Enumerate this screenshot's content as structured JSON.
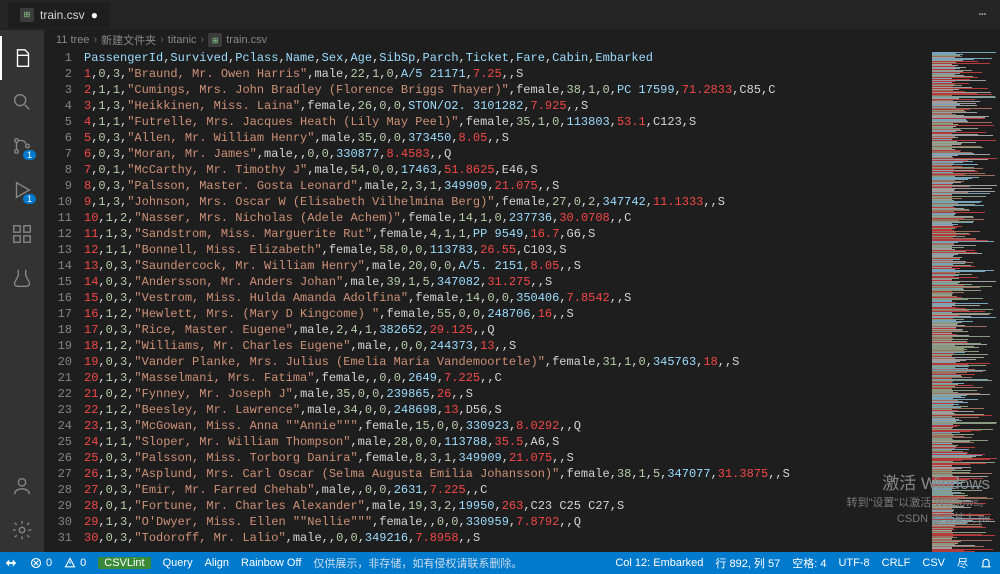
{
  "title_tab": "train.csv",
  "tab_dirty": "●",
  "breadcrumbs": {
    "seg1": "11 tree",
    "seg2": "新建文件夹",
    "seg3": "titanic",
    "seg4": "train.csv"
  },
  "activity_badges": {
    "scm": "1",
    "debug": "1"
  },
  "watermark": {
    "line1": "激活 Windows",
    "line2": "转到\"设置\"以激活 Windows。",
    "line3": "CSDN @书某人.px"
  },
  "statusbar": {
    "errors": "0",
    "warnings": "0",
    "csvlint": "CSVLint",
    "query": "Query",
    "align": "Align",
    "rainbow": "Rainbow Off",
    "mid_text": "仅供展示，非存储，如有侵权请联系删除。",
    "col_label": "Col 12: Embarked",
    "pos": "行 892, 列 57",
    "spaces": "空格: 4",
    "encoding": "UTF-8",
    "eol": "CRLF",
    "lang": "CSV",
    "feedback": "尽"
  },
  "header_cols": [
    "PassengerId",
    "Survived",
    "Pclass",
    "Name",
    "Sex",
    "Age",
    "SibSp",
    "Parch",
    "Ticket",
    "Fare",
    "Cabin",
    "Embarked"
  ],
  "rows": [
    {
      "id": "1",
      "sv": "0",
      "pc": "3",
      "nm": "Braund, Mr. Owen Harris",
      "sx": "male",
      "ag": "22",
      "sp": "1",
      "pa": "0",
      "tk": "A/5 21171",
      "fr": "7.25",
      "cb": "",
      "em": "S"
    },
    {
      "id": "2",
      "sv": "1",
      "pc": "1",
      "nm": "Cumings, Mrs. John Bradley (Florence Briggs Thayer)",
      "sx": "female",
      "ag": "38",
      "sp": "1",
      "pa": "0",
      "tk": "PC 17599",
      "fr": "71.2833",
      "cb": "C85",
      "em": "C"
    },
    {
      "id": "3",
      "sv": "1",
      "pc": "3",
      "nm": "Heikkinen, Miss. Laina",
      "sx": "female",
      "ag": "26",
      "sp": "0",
      "pa": "0",
      "tk": "STON/O2. 3101282",
      "fr": "7.925",
      "cb": "",
      "em": "S"
    },
    {
      "id": "4",
      "sv": "1",
      "pc": "1",
      "nm": "Futrelle, Mrs. Jacques Heath (Lily May Peel)",
      "sx": "female",
      "ag": "35",
      "sp": "1",
      "pa": "0",
      "tk": "113803",
      "fr": "53.1",
      "cb": "C123",
      "em": "S"
    },
    {
      "id": "5",
      "sv": "0",
      "pc": "3",
      "nm": "Allen, Mr. William Henry",
      "sx": "male",
      "ag": "35",
      "sp": "0",
      "pa": "0",
      "tk": "373450",
      "fr": "8.05",
      "cb": "",
      "em": "S"
    },
    {
      "id": "6",
      "sv": "0",
      "pc": "3",
      "nm": "Moran, Mr. James",
      "sx": "male",
      "ag": "",
      "sp": "0",
      "pa": "0",
      "tk": "330877",
      "fr": "8.4583",
      "cb": "",
      "em": "Q"
    },
    {
      "id": "7",
      "sv": "0",
      "pc": "1",
      "nm": "McCarthy, Mr. Timothy J",
      "sx": "male",
      "ag": "54",
      "sp": "0",
      "pa": "0",
      "tk": "17463",
      "fr": "51.8625",
      "cb": "E46",
      "em": "S"
    },
    {
      "id": "8",
      "sv": "0",
      "pc": "3",
      "nm": "Palsson, Master. Gosta Leonard",
      "sx": "male",
      "ag": "2",
      "sp": "3",
      "pa": "1",
      "tk": "349909",
      "fr": "21.075",
      "cb": "",
      "em": "S"
    },
    {
      "id": "9",
      "sv": "1",
      "pc": "3",
      "nm": "Johnson, Mrs. Oscar W (Elisabeth Vilhelmina Berg)",
      "sx": "female",
      "ag": "27",
      "sp": "0",
      "pa": "2",
      "tk": "347742",
      "fr": "11.1333",
      "cb": "",
      "em": "S"
    },
    {
      "id": "10",
      "sv": "1",
      "pc": "2",
      "nm": "Nasser, Mrs. Nicholas (Adele Achem)",
      "sx": "female",
      "ag": "14",
      "sp": "1",
      "pa": "0",
      "tk": "237736",
      "fr": "30.0708",
      "cb": "",
      "em": "C"
    },
    {
      "id": "11",
      "sv": "1",
      "pc": "3",
      "nm": "Sandstrom, Miss. Marguerite Rut",
      "sx": "female",
      "ag": "4",
      "sp": "1",
      "pa": "1",
      "tk": "PP 9549",
      "fr": "16.7",
      "cb": "G6",
      "em": "S"
    },
    {
      "id": "12",
      "sv": "1",
      "pc": "1",
      "nm": "Bonnell, Miss. Elizabeth",
      "sx": "female",
      "ag": "58",
      "sp": "0",
      "pa": "0",
      "tk": "113783",
      "fr": "26.55",
      "cb": "C103",
      "em": "S"
    },
    {
      "id": "13",
      "sv": "0",
      "pc": "3",
      "nm": "Saundercock, Mr. William Henry",
      "sx": "male",
      "ag": "20",
      "sp": "0",
      "pa": "0",
      "tk": "A/5. 2151",
      "fr": "8.05",
      "cb": "",
      "em": "S"
    },
    {
      "id": "14",
      "sv": "0",
      "pc": "3",
      "nm": "Andersson, Mr. Anders Johan",
      "sx": "male",
      "ag": "39",
      "sp": "1",
      "pa": "5",
      "tk": "347082",
      "fr": "31.275",
      "cb": "",
      "em": "S"
    },
    {
      "id": "15",
      "sv": "0",
      "pc": "3",
      "nm": "Vestrom, Miss. Hulda Amanda Adolfina",
      "sx": "female",
      "ag": "14",
      "sp": "0",
      "pa": "0",
      "tk": "350406",
      "fr": "7.8542",
      "cb": "",
      "em": "S"
    },
    {
      "id": "16",
      "sv": "1",
      "pc": "2",
      "nm": "Hewlett, Mrs. (Mary D Kingcome) ",
      "sx": "female",
      "ag": "55",
      "sp": "0",
      "pa": "0",
      "tk": "248706",
      "fr": "16",
      "cb": "",
      "em": "S"
    },
    {
      "id": "17",
      "sv": "0",
      "pc": "3",
      "nm": "Rice, Master. Eugene",
      "sx": "male",
      "ag": "2",
      "sp": "4",
      "pa": "1",
      "tk": "382652",
      "fr": "29.125",
      "cb": "",
      "em": "Q"
    },
    {
      "id": "18",
      "sv": "1",
      "pc": "2",
      "nm": "Williams, Mr. Charles Eugene",
      "sx": "male",
      "ag": "",
      "sp": "0",
      "pa": "0",
      "tk": "244373",
      "fr": "13",
      "cb": "",
      "em": "S"
    },
    {
      "id": "19",
      "sv": "0",
      "pc": "3",
      "nm": "Vander Planke, Mrs. Julius (Emelia Maria Vandemoortele)",
      "sx": "female",
      "ag": "31",
      "sp": "1",
      "pa": "0",
      "tk": "345763",
      "fr": "18",
      "cb": "",
      "em": "S"
    },
    {
      "id": "20",
      "sv": "1",
      "pc": "3",
      "nm": "Masselmani, Mrs. Fatima",
      "sx": "female",
      "ag": "",
      "sp": "0",
      "pa": "0",
      "tk": "2649",
      "fr": "7.225",
      "cb": "",
      "em": "C"
    },
    {
      "id": "21",
      "sv": "0",
      "pc": "2",
      "nm": "Fynney, Mr. Joseph J",
      "sx": "male",
      "ag": "35",
      "sp": "0",
      "pa": "0",
      "tk": "239865",
      "fr": "26",
      "cb": "",
      "em": "S"
    },
    {
      "id": "22",
      "sv": "1",
      "pc": "2",
      "nm": "Beesley, Mr. Lawrence",
      "sx": "male",
      "ag": "34",
      "sp": "0",
      "pa": "0",
      "tk": "248698",
      "fr": "13",
      "cb": "D56",
      "em": "S"
    },
    {
      "id": "23",
      "sv": "1",
      "pc": "3",
      "nm": "McGowan, Miss. Anna \"\"Annie\"\"",
      "sx": "female",
      "ag": "15",
      "sp": "0",
      "pa": "0",
      "tk": "330923",
      "fr": "8.0292",
      "cb": "",
      "em": "Q"
    },
    {
      "id": "24",
      "sv": "1",
      "pc": "1",
      "nm": "Sloper, Mr. William Thompson",
      "sx": "male",
      "ag": "28",
      "sp": "0",
      "pa": "0",
      "tk": "113788",
      "fr": "35.5",
      "cb": "A6",
      "em": "S"
    },
    {
      "id": "25",
      "sv": "0",
      "pc": "3",
      "nm": "Palsson, Miss. Torborg Danira",
      "sx": "female",
      "ag": "8",
      "sp": "3",
      "pa": "1",
      "tk": "349909",
      "fr": "21.075",
      "cb": "",
      "em": "S"
    },
    {
      "id": "26",
      "sv": "1",
      "pc": "3",
      "nm": "Asplund, Mrs. Carl Oscar (Selma Augusta Emilia Johansson)",
      "sx": "female",
      "ag": "38",
      "sp": "1",
      "pa": "5",
      "tk": "347077",
      "fr": "31.3875",
      "cb": "",
      "em": "S"
    },
    {
      "id": "27",
      "sv": "0",
      "pc": "3",
      "nm": "Emir, Mr. Farred Chehab",
      "sx": "male",
      "ag": "",
      "sp": "0",
      "pa": "0",
      "tk": "2631",
      "fr": "7.225",
      "cb": "",
      "em": "C"
    },
    {
      "id": "28",
      "sv": "0",
      "pc": "1",
      "nm": "Fortune, Mr. Charles Alexander",
      "sx": "male",
      "ag": "19",
      "sp": "3",
      "pa": "2",
      "tk": "19950",
      "fr": "263",
      "cb": "C23 C25 C27",
      "em": "S"
    },
    {
      "id": "29",
      "sv": "1",
      "pc": "3",
      "nm": "O'Dwyer, Miss. Ellen \"\"Nellie\"\"",
      "sx": "female",
      "ag": "",
      "sp": "0",
      "pa": "0",
      "tk": "330959",
      "fr": "7.8792",
      "cb": "",
      "em": "Q"
    },
    {
      "id": "30",
      "sv": "0",
      "pc": "3",
      "nm": "Todoroff, Mr. Lalio",
      "sx": "male",
      "ag": "",
      "sp": "0",
      "pa": "0",
      "tk": "349216",
      "fr": "7.8958",
      "cb": "",
      "em": "S"
    }
  ]
}
